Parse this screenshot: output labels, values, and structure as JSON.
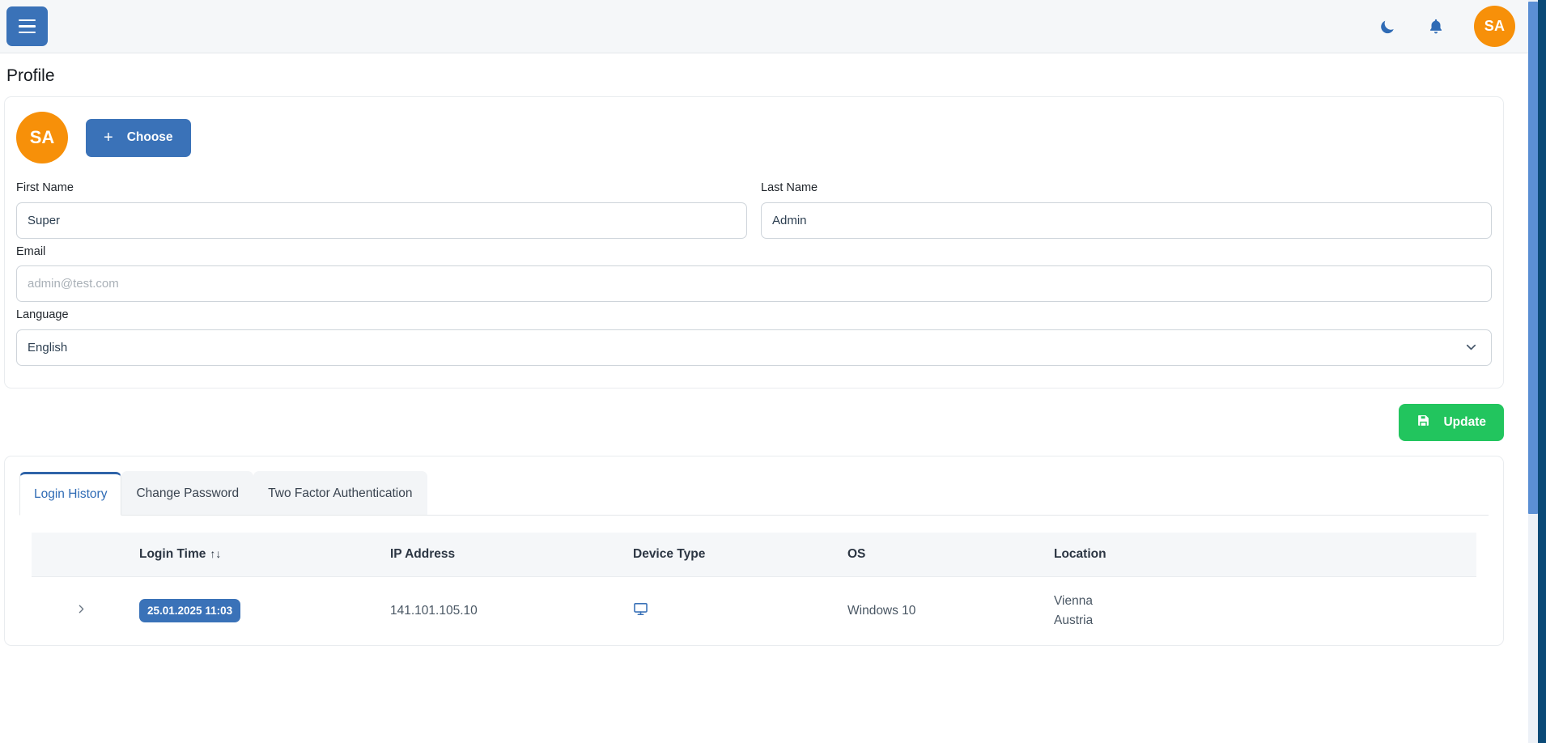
{
  "navbar": {
    "menu_button_label": "menu",
    "dark_mode_icon": "moon-icon",
    "notification_icon": "bell-icon",
    "avatar_initials": "SA"
  },
  "page": {
    "title": "Profile"
  },
  "profile_card": {
    "avatar_initials": "SA",
    "choose_button_label": "Choose",
    "choose_button_icon": "plus-icon",
    "fields": {
      "first_name": {
        "label": "First Name",
        "value": "Super",
        "placeholder": ""
      },
      "last_name": {
        "label": "Last Name",
        "value": "Admin",
        "placeholder": ""
      },
      "email": {
        "label": "Email",
        "value": "",
        "placeholder": "admin@test.com"
      },
      "language": {
        "label": "Language",
        "value": "English",
        "options": [
          "English"
        ]
      }
    },
    "update_button_label": "Update",
    "update_button_icon": "save-icon"
  },
  "tabs": [
    {
      "label": "Login History",
      "active": true
    },
    {
      "label": "Change Password",
      "active": false
    },
    {
      "label": "Two Factor Authentication",
      "active": false
    }
  ],
  "login_history": {
    "columns": [
      {
        "key": "expand",
        "label": ""
      },
      {
        "key": "login_time",
        "label": "Login Time",
        "sortable": true,
        "sort_icon": "↑↓"
      },
      {
        "key": "ip_address",
        "label": "IP Address"
      },
      {
        "key": "device_type",
        "label": "Device Type"
      },
      {
        "key": "os",
        "label": "OS"
      },
      {
        "key": "location",
        "label": "Location"
      }
    ],
    "rows": [
      {
        "expand_icon": "chevron-right-icon",
        "login_time": "25.01.2025 11:03",
        "ip_address": "141.101.105.10",
        "device_type_icon": "desktop-icon",
        "os": "Windows 10",
        "location_city": "Vienna",
        "location_country": "Austria"
      }
    ]
  },
  "colors": {
    "primary": "#3a72b8",
    "accent_orange": "#f79009",
    "success_green": "#22c55e",
    "tab_active_text": "#2f6bb5",
    "navbar_bg": "#f5f7f9"
  }
}
